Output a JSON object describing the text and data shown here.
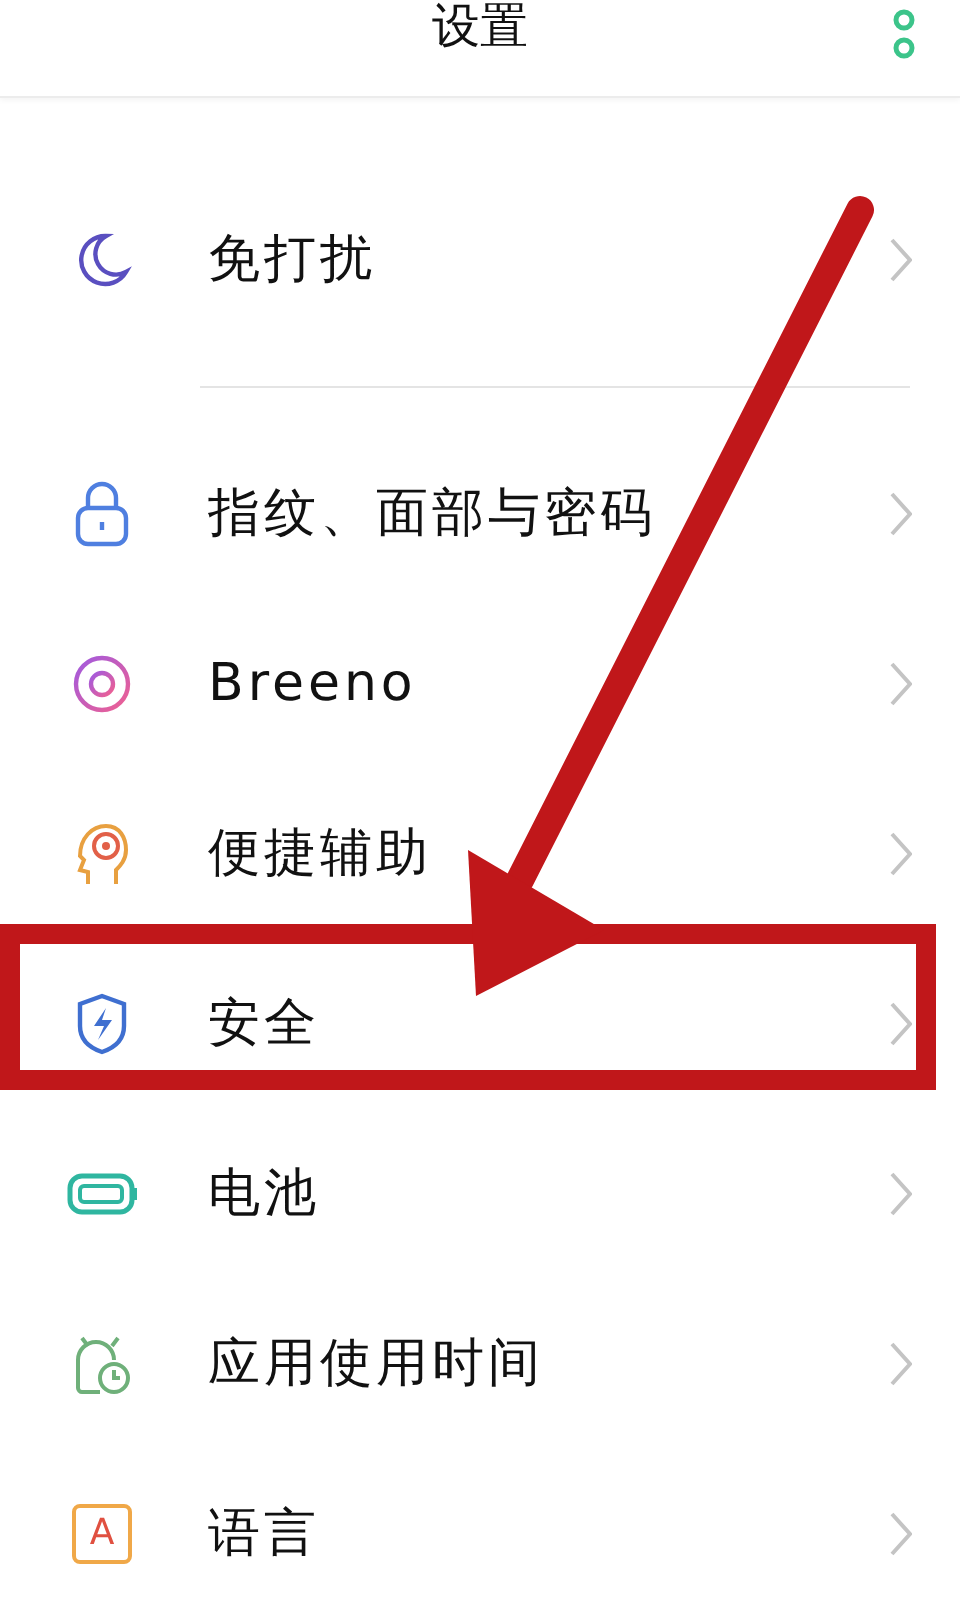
{
  "header": {
    "title": "设置"
  },
  "sections": [
    {
      "items": [
        {
          "label": "免打扰",
          "highlighted": false
        }
      ]
    },
    {
      "items": [
        {
          "label": "指纹、面部与密码",
          "highlighted": false
        },
        {
          "label": "Breeno",
          "highlighted": false
        },
        {
          "label": "便捷辅助",
          "highlighted": false
        },
        {
          "label": "安全",
          "highlighted": true
        },
        {
          "label": "电池",
          "highlighted": false
        },
        {
          "label": "应用使用时间",
          "highlighted": false
        },
        {
          "label": "语言",
          "icon_letter": "A",
          "highlighted": false
        }
      ]
    }
  ]
}
